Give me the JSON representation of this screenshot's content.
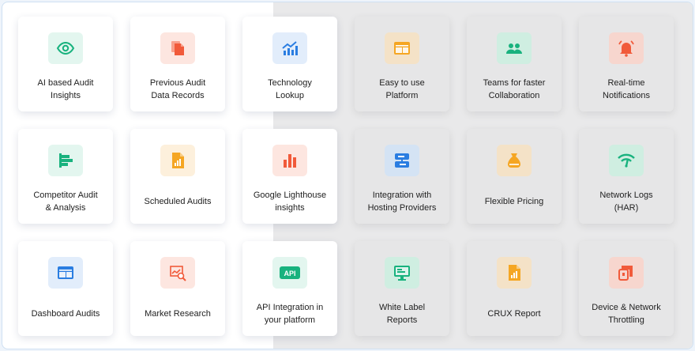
{
  "features": [
    {
      "label": "AI based Audit\nInsights",
      "icon": "eye-icon",
      "color": "#18b27e"
    },
    {
      "label": "Previous Audit\nData Records",
      "icon": "documents-icon",
      "color": "#f15a3a"
    },
    {
      "label": "Technology\nLookup",
      "icon": "trend-chart-icon",
      "color": "#2a7de1"
    },
    {
      "label": "Easy to use\nPlatform",
      "icon": "browser-window-icon",
      "color": "#f5a623"
    },
    {
      "label": "Teams for faster\nCollaboration",
      "icon": "team-icon",
      "color": "#18b27e"
    },
    {
      "label": "Real-time\nNotifications",
      "icon": "bell-icon",
      "color": "#f15a3a"
    },
    {
      "label": "Competitor Audit\n& Analysis",
      "icon": "bar-list-icon",
      "color": "#18b27e"
    },
    {
      "label": "Scheduled Audits",
      "icon": "report-file-icon",
      "color": "#f5a623"
    },
    {
      "label": "Google Lighthouse\ninsights",
      "icon": "bar-chart-icon",
      "color": "#f15a3a"
    },
    {
      "label": "Integration with\nHosting Providers",
      "icon": "servers-icon",
      "color": "#2a7de1"
    },
    {
      "label": "Flexible Pricing",
      "icon": "money-bag-icon",
      "color": "#f5a623"
    },
    {
      "label": "Network Logs\n(HAR)",
      "icon": "wifi-signal-icon",
      "color": "#18b27e"
    },
    {
      "label": "Dashboard Audits",
      "icon": "dashboard-icon",
      "color": "#2a7de1"
    },
    {
      "label": "Market Research",
      "icon": "magnifier-chart-icon",
      "color": "#f15a3a"
    },
    {
      "label": "API Integration in\nyour platform",
      "icon": "api-icon",
      "color": "#18b27e"
    },
    {
      "label": "White Label\nReports",
      "icon": "monitor-icon",
      "color": "#18b27e"
    },
    {
      "label": "CRUX Report",
      "icon": "report-file-icon",
      "color": "#f5a623"
    },
    {
      "label": "Device & Network\nThrottling",
      "icon": "devices-icon",
      "color": "#f15a3a"
    }
  ],
  "api_badge": "API"
}
